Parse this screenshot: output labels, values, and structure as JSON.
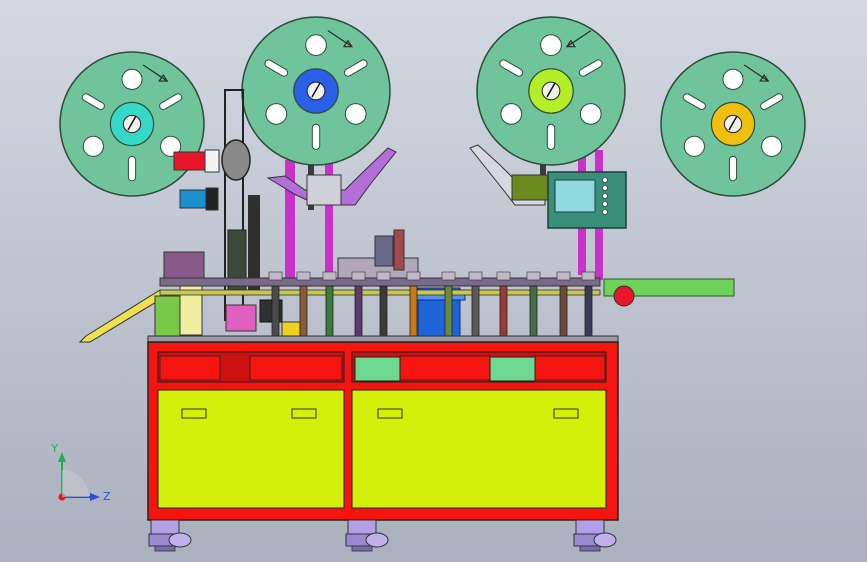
{
  "viewport": {
    "background_top": "#d3d8e2",
    "background_bottom": "#aab0bd"
  },
  "colors": {
    "reel": "#6fc49b",
    "reel_edge": "#2d4a3a",
    "frame_red": "#f5140f",
    "panel_yellow": "#d2f00a",
    "frame_purple": "#c832c8",
    "conveyor_green": "#6fd35a",
    "chute_yellow": "#f0e050",
    "hmi_teal": "#3a8f7a",
    "hmi_screen": "#8fd8e0",
    "part_blue": "#1f63d8",
    "leg_purple": "#b4a0e6"
  },
  "reels": [
    {
      "name": "reel-1",
      "hub_color": "#38d8c8"
    },
    {
      "name": "reel-2",
      "hub_color": "#2a5fe8"
    },
    {
      "name": "reel-3",
      "hub_color": "#b4ee28"
    },
    {
      "name": "reel-4",
      "hub_color": "#f0c010"
    }
  ],
  "axis_triad": {
    "y_label": "Y",
    "z_label": "Z",
    "y_color": "#1bb34a",
    "z_color": "#2b4fd8",
    "origin_color": "#d81b1b"
  }
}
